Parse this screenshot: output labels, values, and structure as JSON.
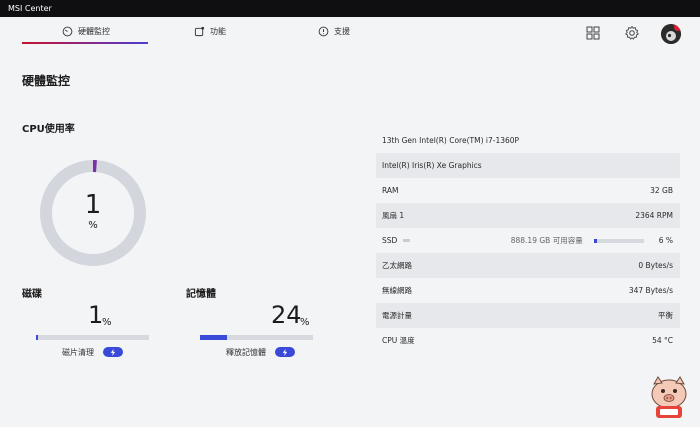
{
  "window": {
    "title": "MSI Center"
  },
  "nav": {
    "tabs": [
      {
        "label": "硬體監控",
        "icon": "gauge-icon"
      },
      {
        "label": "功能",
        "icon": "feature-icon"
      },
      {
        "label": "支援",
        "icon": "support-icon"
      }
    ],
    "icons": [
      "grid-icon",
      "gear-icon",
      "avatar"
    ]
  },
  "page": {
    "title": "硬體監控"
  },
  "cpu": {
    "title": "CPU使用率",
    "value": "1",
    "unit": "%",
    "usage_fraction": 0.01
  },
  "disk": {
    "title": "磁碟",
    "value": "1",
    "unit": "%",
    "usage_fraction": 0.01,
    "action_label": "磁片清理"
  },
  "memory": {
    "title": "記憶體",
    "value": "24",
    "unit": "%",
    "usage_fraction": 0.24,
    "action_label": "釋放記憶體"
  },
  "info": {
    "cpu_name": "13th Gen Intel(R) Core(TM) i7-1360P",
    "gpu_name": "Intel(R) Iris(R) Xe Graphics",
    "rows": [
      {
        "label": "RAM",
        "value": "32 GB"
      },
      {
        "label": "風扇 1",
        "value": "2364 RPM"
      },
      {
        "label": "SSD",
        "value": "6 %",
        "capacity": "888.19 GB 可用容量",
        "usage_fraction": 0.06
      },
      {
        "label": "乙太網路",
        "value": "0 Bytes/s"
      },
      {
        "label": "無線網路",
        "value": "347 Bytes/s"
      },
      {
        "label": "電源計量",
        "value": "平衡"
      },
      {
        "label": "CPU 溫度",
        "value": "54 °C"
      }
    ]
  },
  "colors": {
    "accent": "#3a4ad8",
    "donut_track": "#d3d6dc",
    "donut_fill": "#7b2fa8",
    "titlebar": "#0f0f12"
  }
}
